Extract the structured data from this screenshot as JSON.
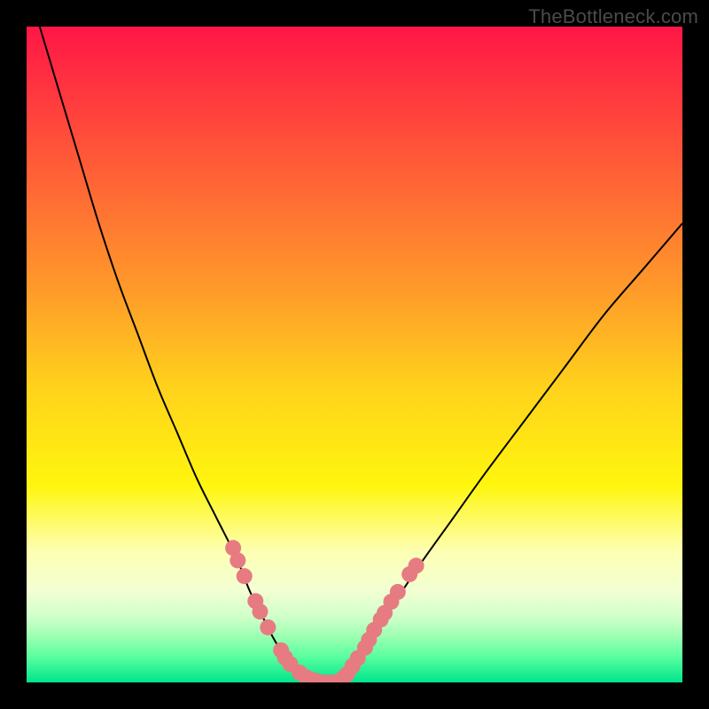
{
  "watermark": "TheBottleneck.com",
  "chart_data": {
    "type": "line",
    "title": "",
    "xlabel": "",
    "ylabel": "",
    "xlim": [
      0,
      100
    ],
    "ylim": [
      0,
      100
    ],
    "series": [
      {
        "name": "bottleneck-curve",
        "x": [
          2,
          5,
          8,
          11,
          14,
          17,
          20,
          23,
          26,
          29,
          32,
          34,
          36,
          37.5,
          39,
          40.5,
          42,
          43.5,
          45,
          47,
          49,
          52,
          56,
          60,
          65,
          70,
          76,
          82,
          88,
          94,
          100
        ],
        "y": [
          100,
          90,
          80,
          70,
          61,
          53,
          45,
          38,
          31,
          25,
          19,
          14,
          10,
          7,
          4.5,
          2.5,
          1.2,
          0.4,
          0,
          0,
          1.8,
          6,
          12,
          18,
          25,
          32,
          40,
          48,
          56,
          63,
          70
        ]
      }
    ],
    "scatter_overlay": {
      "name": "gpu-points",
      "color": "#e77b82",
      "points": [
        {
          "x": 31.5,
          "y": 20.5
        },
        {
          "x": 32.2,
          "y": 18.6
        },
        {
          "x": 33.2,
          "y": 16.2
        },
        {
          "x": 34.9,
          "y": 12.4
        },
        {
          "x": 35.6,
          "y": 10.8
        },
        {
          "x": 36.8,
          "y": 8.4
        },
        {
          "x": 38.8,
          "y": 4.9
        },
        {
          "x": 39.4,
          "y": 3.8
        },
        {
          "x": 40.2,
          "y": 2.8
        },
        {
          "x": 41.6,
          "y": 1.5
        },
        {
          "x": 42.6,
          "y": 0.8
        },
        {
          "x": 43.3,
          "y": 0.5
        },
        {
          "x": 44.2,
          "y": 0.2
        },
        {
          "x": 45.3,
          "y": 0.0
        },
        {
          "x": 46.4,
          "y": 0.0
        },
        {
          "x": 47.6,
          "y": 0.2
        },
        {
          "x": 48.3,
          "y": 0.7
        },
        {
          "x": 48.9,
          "y": 1.3
        },
        {
          "x": 49.7,
          "y": 2.5
        },
        {
          "x": 50.5,
          "y": 3.7
        },
        {
          "x": 51.6,
          "y": 5.3
        },
        {
          "x": 52.2,
          "y": 6.5
        },
        {
          "x": 53.0,
          "y": 8.0
        },
        {
          "x": 54.0,
          "y": 9.6
        },
        {
          "x": 54.6,
          "y": 10.6
        },
        {
          "x": 55.6,
          "y": 12.3
        },
        {
          "x": 56.6,
          "y": 13.8
        },
        {
          "x": 58.4,
          "y": 16.5
        },
        {
          "x": 59.4,
          "y": 17.8
        }
      ]
    },
    "gradient_stops": [
      {
        "offset": 0.0,
        "color": "#ff1646"
      },
      {
        "offset": 0.2,
        "color": "#ff5838"
      },
      {
        "offset": 0.4,
        "color": "#ff9a2a"
      },
      {
        "offset": 0.55,
        "color": "#ffd21c"
      },
      {
        "offset": 0.7,
        "color": "#fff60e"
      },
      {
        "offset": 0.8,
        "color": "#fdffb3"
      },
      {
        "offset": 0.86,
        "color": "#f3ffd3"
      },
      {
        "offset": 0.9,
        "color": "#d0ffca"
      },
      {
        "offset": 0.93,
        "color": "#9cffb2"
      },
      {
        "offset": 0.96,
        "color": "#5bffa0"
      },
      {
        "offset": 1.0,
        "color": "#00e58c"
      }
    ]
  }
}
